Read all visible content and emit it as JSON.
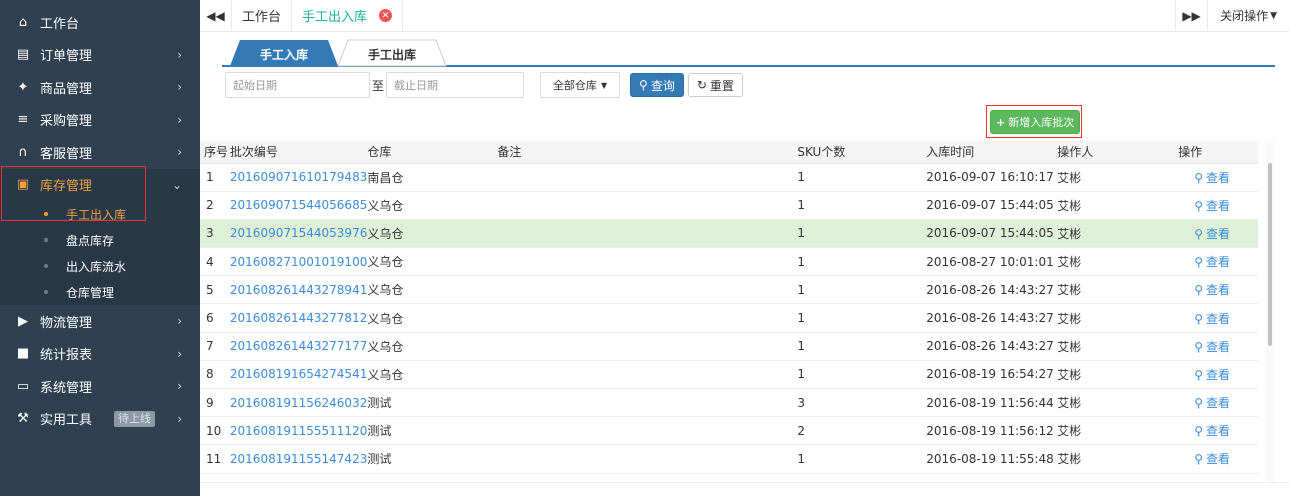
{
  "sidebar": {
    "items": [
      {
        "label": "工作台",
        "icon": "home-icon"
      },
      {
        "label": "订单管理",
        "icon": "clipboard-icon"
      },
      {
        "label": "商品管理",
        "icon": "gift-icon"
      },
      {
        "label": "采购管理",
        "icon": "cart-icon"
      },
      {
        "label": "客服管理",
        "icon": "headset-icon"
      },
      {
        "label": "库存管理",
        "icon": "archive-icon"
      },
      {
        "label": "物流管理",
        "icon": "truck-icon"
      },
      {
        "label": "统计报表",
        "icon": "report-icon"
      },
      {
        "label": "系统管理",
        "icon": "monitor-icon"
      },
      {
        "label": "实用工具",
        "icon": "wrench-icon",
        "badge": "待上线"
      }
    ],
    "sub_items": [
      "手工出入库",
      "盘点库存",
      "出入库流水",
      "仓库管理"
    ]
  },
  "topbar": {
    "back_icon": "double-left-icon",
    "fwd_icon": "double-right-icon",
    "tabs": [
      "工作台",
      "手工出入库"
    ],
    "close_ops": "关闭操作"
  },
  "subtabs": [
    "手工入库",
    "手工出库"
  ],
  "filter": {
    "start_placeholder": "起始日期",
    "to": "至",
    "end_placeholder": "截止日期",
    "warehouse": "全部仓库",
    "query": "查询",
    "reset": "重置"
  },
  "add_batch": "新增入库批次",
  "table": {
    "headers": [
      "序号",
      "批次编号",
      "仓库",
      "备注",
      "SKU个数",
      "入库时间",
      "操作人",
      "操作"
    ],
    "action_label": "查看",
    "rows": [
      {
        "no": "1",
        "batch": "201609071610179483",
        "wh": "南昌仓",
        "note": "",
        "sku": "1",
        "time": "2016-09-07 16:10:17",
        "op": "艾彬"
      },
      {
        "no": "2",
        "batch": "201609071544056685",
        "wh": "义乌仓",
        "note": "",
        "sku": "1",
        "time": "2016-09-07 15:44:05",
        "op": "艾彬"
      },
      {
        "no": "3",
        "batch": "201609071544053976",
        "wh": "义乌仓",
        "note": "",
        "sku": "1",
        "time": "2016-09-07 15:44:05",
        "op": "艾彬"
      },
      {
        "no": "4",
        "batch": "201608271001019100",
        "wh": "义乌仓",
        "note": "",
        "sku": "1",
        "time": "2016-08-27 10:01:01",
        "op": "艾彬"
      },
      {
        "no": "5",
        "batch": "201608261443278941",
        "wh": "义乌仓",
        "note": "",
        "sku": "1",
        "time": "2016-08-26 14:43:27",
        "op": "艾彬"
      },
      {
        "no": "6",
        "batch": "201608261443277812",
        "wh": "义乌仓",
        "note": "",
        "sku": "1",
        "time": "2016-08-26 14:43:27",
        "op": "艾彬"
      },
      {
        "no": "7",
        "batch": "201608261443277177",
        "wh": "义乌仓",
        "note": "",
        "sku": "1",
        "time": "2016-08-26 14:43:27",
        "op": "艾彬"
      },
      {
        "no": "8",
        "batch": "201608191654274541",
        "wh": "义乌仓",
        "note": "",
        "sku": "1",
        "time": "2016-08-19 16:54:27",
        "op": "艾彬"
      },
      {
        "no": "9",
        "batch": "201608191156246032",
        "wh": "测试",
        "note": "",
        "sku": "3",
        "time": "2016-08-19 11:56:44",
        "op": "艾彬"
      },
      {
        "no": "10",
        "batch": "201608191155511120",
        "wh": "测试",
        "note": "",
        "sku": "2",
        "time": "2016-08-19 11:56:12",
        "op": "艾彬"
      },
      {
        "no": "11",
        "batch": "201608191155147423",
        "wh": "测试",
        "note": "",
        "sku": "1",
        "time": "2016-08-19 11:55:48",
        "op": "艾彬"
      }
    ]
  },
  "colors": {
    "sidebar": "#2f4050",
    "accent": "#f0a140",
    "primary": "#1ab394",
    "link": "#3b8ddb",
    "query": "#337ab7",
    "add": "#5cb85c",
    "highlight": "#e33"
  }
}
